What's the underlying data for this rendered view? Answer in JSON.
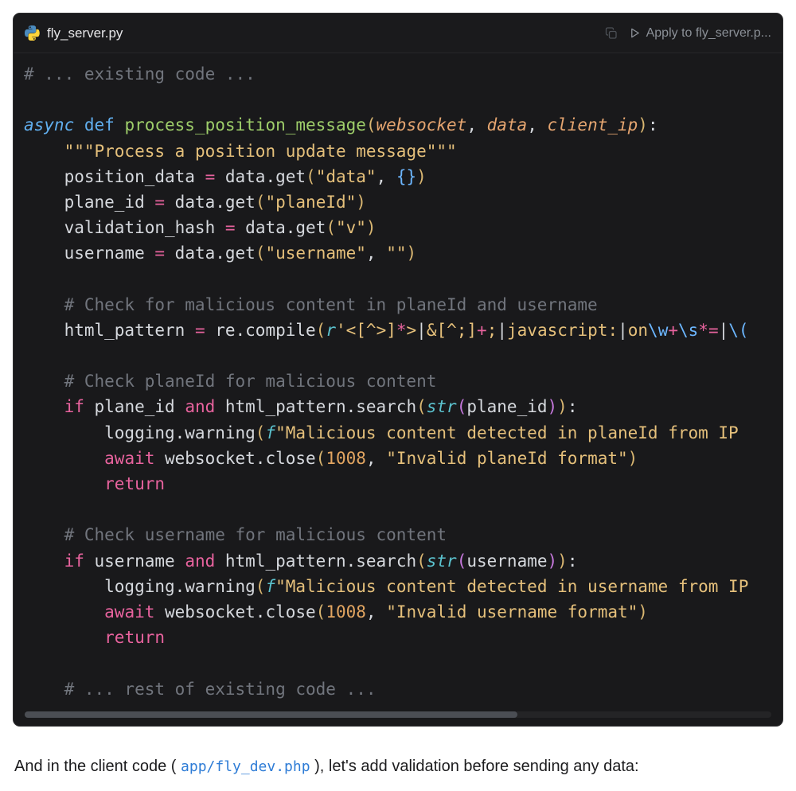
{
  "header": {
    "filename": "fly_server.py",
    "apply_label": "Apply to fly_server.p..."
  },
  "icons": {
    "file_type": "python-icon",
    "copy": "copy-icon",
    "apply_play": "play-icon"
  },
  "colors": {
    "card_background": "#19191b",
    "keyword_pink": "#e8639e",
    "keyword_blue": "#61afef",
    "function_green": "#9ece6a",
    "string_yellow": "#e5c07b",
    "comment_gray": "#71757d",
    "link_blue": "#2e7cd6"
  },
  "code": {
    "lines": [
      [
        {
          "t": "# ... existing code ...",
          "c": "com"
        }
      ],
      [],
      [
        {
          "t": "async ",
          "c": "blueit"
        },
        {
          "t": "def ",
          "c": "blue"
        },
        {
          "t": "process_position_message",
          "c": "fn"
        },
        {
          "t": "(",
          "c": "gold"
        },
        {
          "t": "websocket",
          "c": "param"
        },
        {
          "t": ", ",
          "c": "wh"
        },
        {
          "t": "data",
          "c": "param"
        },
        {
          "t": ", ",
          "c": "wh"
        },
        {
          "t": "client_ip",
          "c": "param"
        },
        {
          "t": ")",
          "c": "gold"
        },
        {
          "t": ":",
          "c": "wh"
        }
      ],
      [
        {
          "t": "    ",
          "c": "wh"
        },
        {
          "t": "\"\"\"Process a position update message\"\"\"",
          "c": "str"
        }
      ],
      [
        {
          "t": "    position_data ",
          "c": "wh"
        },
        {
          "t": "= ",
          "c": "kw"
        },
        {
          "t": "data.get",
          "c": "wh"
        },
        {
          "t": "(",
          "c": "gold"
        },
        {
          "t": "\"data\"",
          "c": "str"
        },
        {
          "t": ", ",
          "c": "wh"
        },
        {
          "t": "{}",
          "c": "blue2"
        },
        {
          "t": ")",
          "c": "gold"
        }
      ],
      [
        {
          "t": "    plane_id ",
          "c": "wh"
        },
        {
          "t": "= ",
          "c": "kw"
        },
        {
          "t": "data.get",
          "c": "wh"
        },
        {
          "t": "(",
          "c": "gold"
        },
        {
          "t": "\"planeId\"",
          "c": "str"
        },
        {
          "t": ")",
          "c": "gold"
        }
      ],
      [
        {
          "t": "    validation_hash ",
          "c": "wh"
        },
        {
          "t": "= ",
          "c": "kw"
        },
        {
          "t": "data.get",
          "c": "wh"
        },
        {
          "t": "(",
          "c": "gold"
        },
        {
          "t": "\"v\"",
          "c": "str"
        },
        {
          "t": ")",
          "c": "gold"
        }
      ],
      [
        {
          "t": "    username ",
          "c": "wh"
        },
        {
          "t": "= ",
          "c": "kw"
        },
        {
          "t": "data.get",
          "c": "wh"
        },
        {
          "t": "(",
          "c": "gold"
        },
        {
          "t": "\"username\"",
          "c": "str"
        },
        {
          "t": ", ",
          "c": "wh"
        },
        {
          "t": "\"\"",
          "c": "str"
        },
        {
          "t": ")",
          "c": "gold"
        }
      ],
      [],
      [
        {
          "t": "    # Check for malicious content in planeId and username",
          "c": "com"
        }
      ],
      [
        {
          "t": "    html_pattern ",
          "c": "wh"
        },
        {
          "t": "= ",
          "c": "kw"
        },
        {
          "t": "re.compile",
          "c": "wh"
        },
        {
          "t": "(",
          "c": "gold"
        },
        {
          "t": "r",
          "c": "cyan"
        },
        {
          "t": "'",
          "c": "str"
        },
        {
          "t": "<[^>]",
          "c": "str"
        },
        {
          "t": "*",
          "c": "kw"
        },
        {
          "t": ">",
          "c": "str"
        },
        {
          "t": "|",
          "c": "wh"
        },
        {
          "t": "&[^;]",
          "c": "str"
        },
        {
          "t": "+",
          "c": "kw"
        },
        {
          "t": ";",
          "c": "str"
        },
        {
          "t": "|",
          "c": "wh"
        },
        {
          "t": "javascript:",
          "c": "str"
        },
        {
          "t": "|",
          "c": "wh"
        },
        {
          "t": "on",
          "c": "str"
        },
        {
          "t": "\\w",
          "c": "blue2"
        },
        {
          "t": "+",
          "c": "kw"
        },
        {
          "t": "\\s",
          "c": "blue2"
        },
        {
          "t": "*",
          "c": "kw"
        },
        {
          "t": "=",
          "c": "kw"
        },
        {
          "t": "|",
          "c": "wh"
        },
        {
          "t": "\\(",
          "c": "blue2"
        }
      ],
      [],
      [
        {
          "t": "    # Check planeId for malicious content",
          "c": "com"
        }
      ],
      [
        {
          "t": "    ",
          "c": "wh"
        },
        {
          "t": "if ",
          "c": "kw"
        },
        {
          "t": "plane_id ",
          "c": "wh"
        },
        {
          "t": "and ",
          "c": "kw"
        },
        {
          "t": "html_pattern.search",
          "c": "wh"
        },
        {
          "t": "(",
          "c": "gold"
        },
        {
          "t": "str",
          "c": "cyan"
        },
        {
          "t": "(",
          "c": "purple"
        },
        {
          "t": "plane_id",
          "c": "wh"
        },
        {
          "t": ")",
          "c": "purple"
        },
        {
          "t": ")",
          "c": "gold"
        },
        {
          "t": ":",
          "c": "wh"
        }
      ],
      [
        {
          "t": "        logging.warning",
          "c": "wh"
        },
        {
          "t": "(",
          "c": "gold"
        },
        {
          "t": "f",
          "c": "cyan"
        },
        {
          "t": "\"Malicious content detected in planeId from IP",
          "c": "str"
        }
      ],
      [
        {
          "t": "        ",
          "c": "wh"
        },
        {
          "t": "await ",
          "c": "kw"
        },
        {
          "t": "websocket.close",
          "c": "wh"
        },
        {
          "t": "(",
          "c": "gold"
        },
        {
          "t": "1008",
          "c": "num"
        },
        {
          "t": ", ",
          "c": "wh"
        },
        {
          "t": "\"Invalid planeId format\"",
          "c": "str"
        },
        {
          "t": ")",
          "c": "gold"
        }
      ],
      [
        {
          "t": "        ",
          "c": "wh"
        },
        {
          "t": "return",
          "c": "kw"
        }
      ],
      [],
      [
        {
          "t": "    # Check username for malicious content",
          "c": "com"
        }
      ],
      [
        {
          "t": "    ",
          "c": "wh"
        },
        {
          "t": "if ",
          "c": "kw"
        },
        {
          "t": "username ",
          "c": "wh"
        },
        {
          "t": "and ",
          "c": "kw"
        },
        {
          "t": "html_pattern.search",
          "c": "wh"
        },
        {
          "t": "(",
          "c": "gold"
        },
        {
          "t": "str",
          "c": "cyan"
        },
        {
          "t": "(",
          "c": "purple"
        },
        {
          "t": "username",
          "c": "wh"
        },
        {
          "t": ")",
          "c": "purple"
        },
        {
          "t": ")",
          "c": "gold"
        },
        {
          "t": ":",
          "c": "wh"
        }
      ],
      [
        {
          "t": "        logging.warning",
          "c": "wh"
        },
        {
          "t": "(",
          "c": "gold"
        },
        {
          "t": "f",
          "c": "cyan"
        },
        {
          "t": "\"Malicious content detected in username from IP",
          "c": "str"
        }
      ],
      [
        {
          "t": "        ",
          "c": "wh"
        },
        {
          "t": "await ",
          "c": "kw"
        },
        {
          "t": "websocket.close",
          "c": "wh"
        },
        {
          "t": "(",
          "c": "gold"
        },
        {
          "t": "1008",
          "c": "num"
        },
        {
          "t": ", ",
          "c": "wh"
        },
        {
          "t": "\"Invalid username format\"",
          "c": "str"
        },
        {
          "t": ")",
          "c": "gold"
        }
      ],
      [
        {
          "t": "        ",
          "c": "wh"
        },
        {
          "t": "return",
          "c": "kw"
        }
      ],
      [],
      [
        {
          "t": "    # ... rest of existing code ...",
          "c": "com"
        }
      ]
    ]
  },
  "footer": {
    "text_before": "And in the client code ( ",
    "link": "app/fly_dev.php",
    "text_after": " ), let's add validation before sending any data:"
  }
}
